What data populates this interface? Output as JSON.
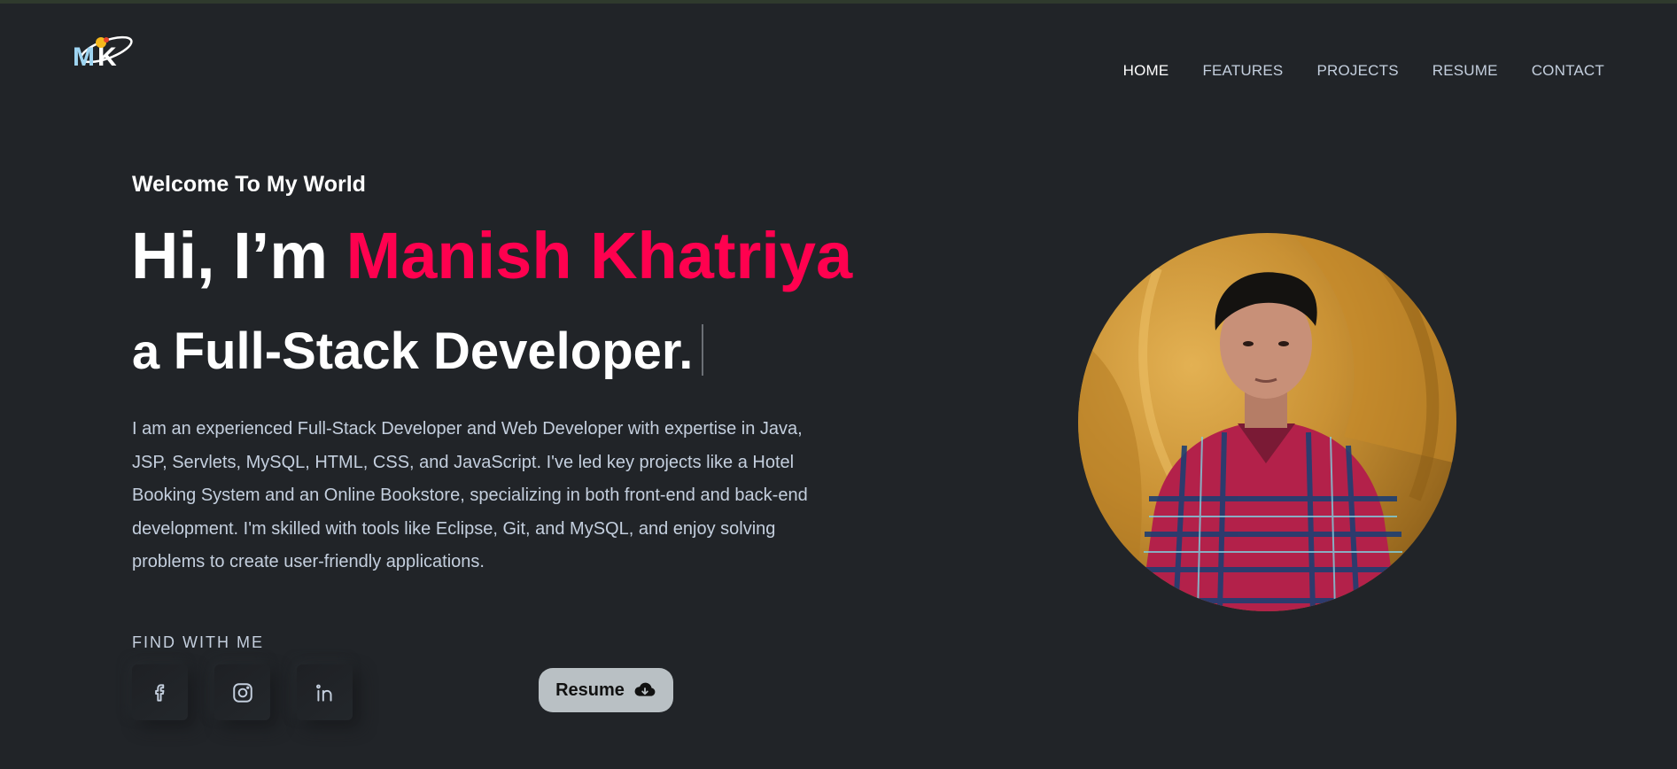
{
  "header": {
    "logo_text": "MK",
    "nav": [
      {
        "label": "HOME",
        "active": true
      },
      {
        "label": "FEATURES",
        "active": false
      },
      {
        "label": "PROJECTS",
        "active": false
      },
      {
        "label": "RESUME",
        "active": false
      },
      {
        "label": "CONTACT",
        "active": false
      }
    ]
  },
  "hero": {
    "welcome": "Welcome To My World",
    "greeting": "Hi, I’m ",
    "name": "Manish Khatriya",
    "role_prefix": "a ",
    "role": "Full-Stack Developer.",
    "description": "I am an experienced Full-Stack Developer and Web Developer with expertise in Java, JSP, Servlets, MySQL, HTML, CSS, and JavaScript. I've led key projects like a Hotel Booking System and an Online Bookstore, specializing in both front-end and back-end development. I'm skilled with tools like Eclipse, Git, and MySQL, and enjoy solving problems to create user-friendly applications."
  },
  "social": {
    "label": "FIND WITH ME",
    "icons": [
      "facebook-icon",
      "instagram-icon",
      "linkedin-icon"
    ]
  },
  "resume_button": {
    "label": "Resume",
    "icon": "cloud-download-icon"
  },
  "colors": {
    "background": "#212428",
    "accent": "#ff014f",
    "text": "#c4cfde",
    "heading": "#ffffff"
  }
}
